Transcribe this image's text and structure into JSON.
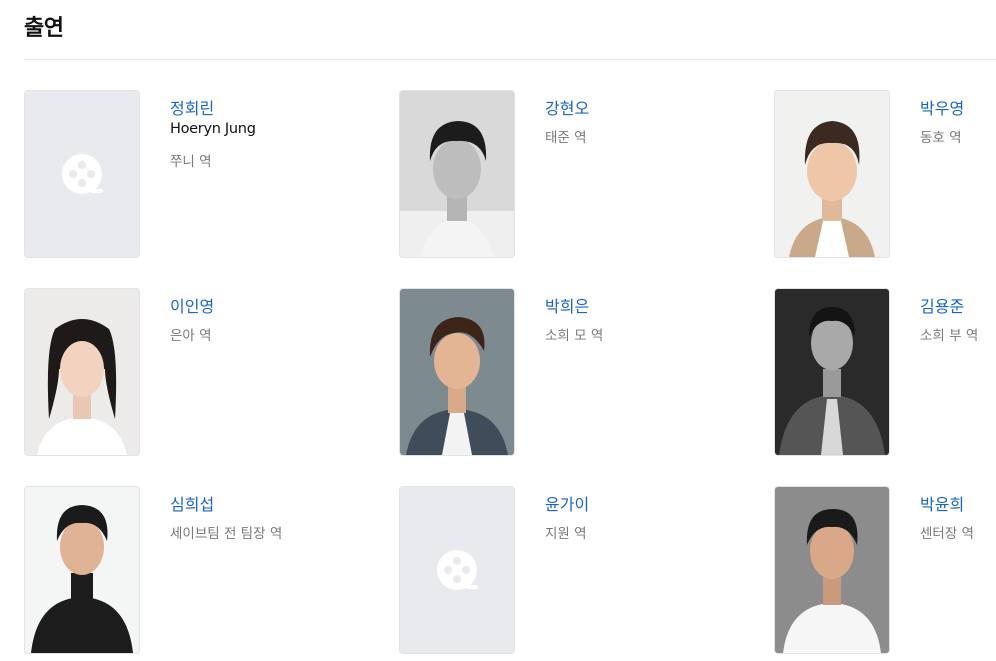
{
  "section": {
    "title": "출연"
  },
  "cast": [
    {
      "name": "정회린",
      "name_en": "Hoeryn Jung",
      "role": "쭈니 역",
      "photo": "placeholder"
    },
    {
      "name": "강현오",
      "role": "태준 역",
      "photo": "bw"
    },
    {
      "name": "박우영",
      "role": "동호 역",
      "photo": "light"
    },
    {
      "name": "이인영",
      "role": "은아 역",
      "photo": "light"
    },
    {
      "name": "박희은",
      "role": "소희 모 역",
      "photo": "gray"
    },
    {
      "name": "김용준",
      "role": "소희 부 역",
      "photo": "dark"
    },
    {
      "name": "심희섭",
      "role": "세이브팀 전 팀장 역",
      "photo": "light"
    },
    {
      "name": "윤가이",
      "role": "지원 역",
      "photo": "placeholder"
    },
    {
      "name": "박윤희",
      "role": "센터장 역",
      "photo": "gray"
    }
  ]
}
